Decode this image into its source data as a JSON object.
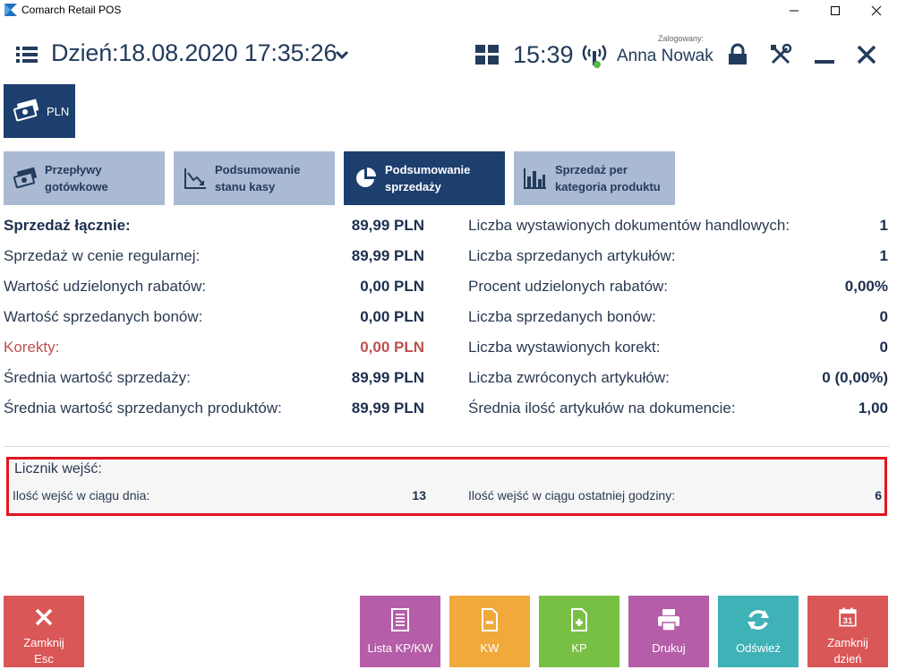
{
  "window": {
    "title": "Comarch Retail POS",
    "logo_color": "#1e73be"
  },
  "header": {
    "date_text": "Dzień:18.08.2020 17:35:26",
    "time": "15:39",
    "logged_label": "Zalogowany:",
    "user": "Anna Nowak",
    "accent_color": "#233b5c",
    "icons": [
      "menu-icon",
      "chevron-down-icon",
      "grid-icon",
      "signal-icon",
      "lock-icon",
      "tools-icon",
      "minimize-icon",
      "close-icon"
    ]
  },
  "currency": {
    "label": "PLN",
    "icon": "banknotes-icon"
  },
  "tabs": [
    {
      "label": "Przepływy\ngotówkowe",
      "icon": "banknotes-icon",
      "active": false
    },
    {
      "label": "Podsumowanie\nstanu kasy",
      "icon": "line-chart-icon",
      "active": false
    },
    {
      "label": "Podsumowanie\nsprzedaży",
      "icon": "pie-chart-icon",
      "active": true
    },
    {
      "label": "Sprzedaż per\nkategoria produktu",
      "icon": "bar-chart-icon",
      "active": false
    }
  ],
  "stats_left": [
    {
      "label": "Sprzedaż łącznie:",
      "value": "89,99 PLN",
      "style": "bold"
    },
    {
      "label": "Sprzedaż w cenie regularnej:",
      "value": "89,99 PLN",
      "style": ""
    },
    {
      "label": "Wartość udzielonych rabatów:",
      "value": "0,00 PLN",
      "style": ""
    },
    {
      "label": "Wartość sprzedanych bonów:",
      "value": "0,00 PLN",
      "style": ""
    },
    {
      "label": "Korekty:",
      "value": "0,00 PLN",
      "style": "red"
    },
    {
      "label": "Średnia wartość sprzedaży:",
      "value": "89,99 PLN",
      "style": ""
    },
    {
      "label": "Średnia wartość sprzedanych produktów:",
      "value": "89,99 PLN",
      "style": ""
    }
  ],
  "stats_right": [
    {
      "label": "Liczba wystawionych dokumentów handlowych:",
      "value": "1"
    },
    {
      "label": "Liczba sprzedanych artykułów:",
      "value": "1"
    },
    {
      "label": "Procent udzielonych rabatów:",
      "value": "0,00%"
    },
    {
      "label": "Liczba sprzedanych bonów:",
      "value": "0"
    },
    {
      "label": "Liczba wystawionych korekt:",
      "value": "0"
    },
    {
      "label": "Liczba zwróconych artykułów:",
      "value": "0 (0,00%)"
    },
    {
      "label": "Średnia ilość artykułów na dokumencie:",
      "value": "1,00"
    }
  ],
  "counter": {
    "title": "Licznik wejść:",
    "day_label": "Ilość wejść w ciągu dnia:",
    "day_value": "13",
    "hour_label": "Ilość wejść w ciągu ostatniej godziny:",
    "hour_value": "6",
    "highlight_color": "#e0161f"
  },
  "buttons": [
    {
      "label": "Zamknij\nEsc",
      "icon": "close-x-icon",
      "color": "#d95757"
    },
    {
      "label": "Lista KP/KW",
      "icon": "list-doc-icon",
      "color": "#b55da8"
    },
    {
      "label": "KW",
      "icon": "doc-minus-icon",
      "color": "#f0a93a"
    },
    {
      "label": "KP",
      "icon": "doc-plus-icon",
      "color": "#78c043"
    },
    {
      "label": "Drukuj",
      "icon": "printer-icon",
      "color": "#b55da8"
    },
    {
      "label": "Odśwież",
      "icon": "refresh-icon",
      "color": "#3fb2b8"
    },
    {
      "label": "Zamknij\ndzień",
      "icon": "calendar-icon",
      "calendar_day": "31",
      "color": "#d95757"
    }
  ]
}
